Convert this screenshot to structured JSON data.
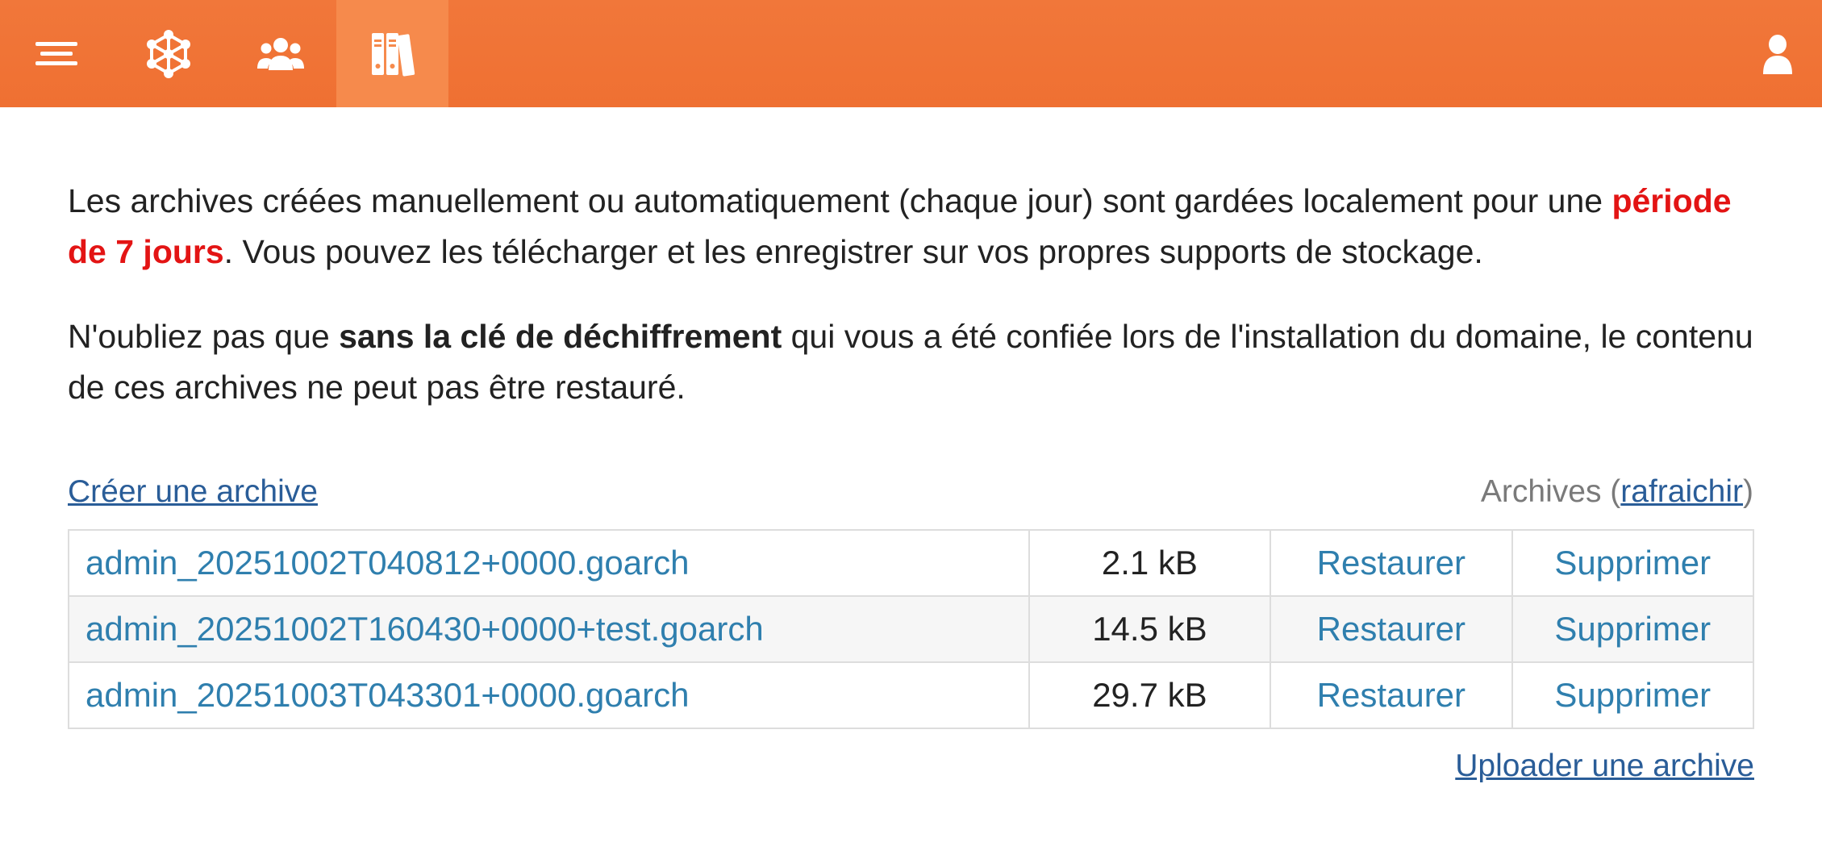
{
  "nav": {
    "items": [
      {
        "icon": "menu-icon"
      },
      {
        "icon": "network-icon"
      },
      {
        "icon": "users-icon"
      },
      {
        "icon": "archives-icon",
        "active": true
      }
    ],
    "user_icon": "user-icon",
    "accent": "#ef7032"
  },
  "intro": {
    "p1_a": "Les archives créées manuellement ou automatiquement (chaque jour) sont gardées localement pour une ",
    "p1_red": "période de 7 jours",
    "p1_b": ". Vous pouvez les télécharger et les enregistrer sur vos propres supports de stockage.",
    "p2_a": "N'oubliez pas que ",
    "p2_bold": "sans la clé de déchiffrement",
    "p2_b": " qui vous a été confiée lors de l'installation du domaine, le contenu de ces archives ne peut pas être restauré."
  },
  "actions": {
    "create_label": "Créer une archive",
    "archives_label": "Archives (",
    "refresh_label": "rafraichir",
    "archives_close": ")",
    "upload_label": "Uploader une archive"
  },
  "archives": [
    {
      "name": "admin_20251002T040812+0000.goarch",
      "size": "2.1 kB",
      "restore": "Restaurer",
      "delete": "Supprimer"
    },
    {
      "name": "admin_20251002T160430+0000+test.goarch",
      "size": "14.5 kB",
      "restore": "Restaurer",
      "delete": "Supprimer"
    },
    {
      "name": "admin_20251003T043301+0000.goarch",
      "size": "29.7 kB",
      "restore": "Restaurer",
      "delete": "Supprimer"
    }
  ]
}
